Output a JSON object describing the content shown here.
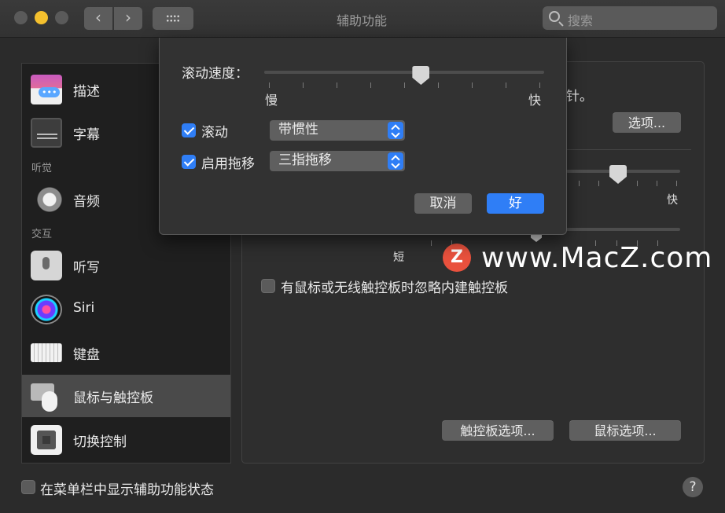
{
  "window": {
    "title": "辅助功能",
    "search_placeholder": "搜索",
    "back_glyph": "‹",
    "forward_glyph": "›"
  },
  "sidebar": {
    "items": [
      {
        "label": "描述",
        "icon": "descriptions-icon"
      },
      {
        "label": "字幕",
        "icon": "captions-icon"
      },
      {
        "label": "音频",
        "icon": "audio-icon"
      },
      {
        "label": "听写",
        "icon": "dictation-icon"
      },
      {
        "label": "Siri",
        "icon": "siri-icon"
      },
      {
        "label": "键盘",
        "icon": "keyboard-icon"
      },
      {
        "label": "鼠标与触控板",
        "icon": "mouse-trackpad-icon",
        "selected": true
      },
      {
        "label": "切换控制",
        "icon": "switch-control-icon"
      }
    ],
    "section_hearing": "听觉",
    "section_interaction": "交互"
  },
  "pane": {
    "partial_text": "针。",
    "options_button": "选项...",
    "fast_label": "快",
    "short_label": "短",
    "ignore_builtin_label": "有鼠标或无线触控板时忽略内建触控板",
    "ignore_builtin_checked": false,
    "trackpad_options_button": "触控板选项...",
    "mouse_options_button": "鼠标选项..."
  },
  "bottom": {
    "show_in_menubar_label": "在菜单栏中显示辅助功能状态",
    "show_in_menubar_checked": false,
    "help_glyph": "?"
  },
  "sheet": {
    "scroll_speed_label": "滚动速度：",
    "slow_label": "慢",
    "fast_label": "快",
    "scroll_speed_value": 0.56,
    "scrolling_label": "滚动",
    "scrolling_checked": true,
    "scrolling_mode": "带惯性",
    "dragging_label": "启用拖移",
    "dragging_checked": true,
    "dragging_mode": "三指拖移",
    "cancel_button": "取消",
    "ok_button": "好"
  },
  "watermark": {
    "logo_letter": "Z",
    "text": "www.MacZ.com"
  },
  "colors": {
    "accent": "#2f7ef6",
    "background": "#2b2b2b",
    "minimize_light": "#f4c02e"
  }
}
